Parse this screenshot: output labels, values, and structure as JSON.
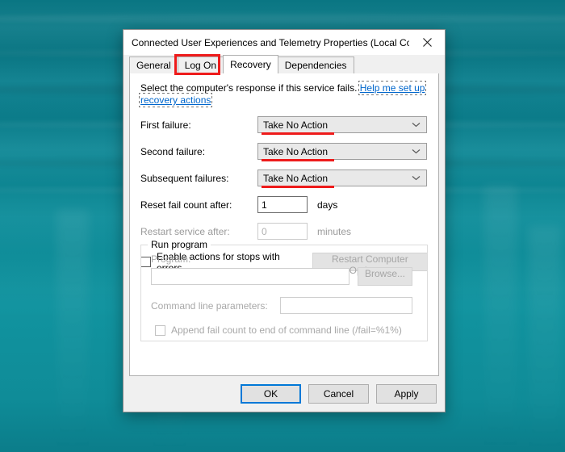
{
  "desktop": {
    "wallpaper_name": "teal-ocean-wallpaper"
  },
  "window": {
    "title": "Connected User Experiences and Telemetry Properties (Local Comp...",
    "close_icon": "close-icon"
  },
  "tabs": [
    {
      "label": "General",
      "active": false
    },
    {
      "label": "Log On",
      "active": false
    },
    {
      "label": "Recovery",
      "active": true
    },
    {
      "label": "Dependencies",
      "active": false
    }
  ],
  "annotations": {
    "tab_box_color": "#ee1b1b",
    "underline_color": "#ee1b1b"
  },
  "recovery": {
    "intro_text": "Select the computer's response if this service fails.",
    "help_link": "Help me set up recovery actions",
    "failure_rows": [
      {
        "label": "First failure:",
        "value": "Take No Action",
        "chevron": "chevron-down-icon"
      },
      {
        "label": "Second failure:",
        "value": "Take No Action",
        "chevron": "chevron-down-icon"
      },
      {
        "label": "Subsequent failures:",
        "value": "Take No Action",
        "chevron": "chevron-down-icon"
      }
    ],
    "reset_fail_count": {
      "label": "Reset fail count after:",
      "value": "1",
      "unit": "days"
    },
    "restart_service_after": {
      "label": "Restart service after:",
      "value": "0",
      "unit": "minutes"
    },
    "enable_actions": {
      "label": "Enable actions for stops with errors.",
      "checked": false
    },
    "restart_computer_options_button": "Restart Computer Options...",
    "run_program": {
      "legend": "Run program",
      "program_label": "Program:",
      "program_value": "",
      "browse_button": "Browse...",
      "command_line_label": "Command line parameters:",
      "command_line_value": "",
      "append_checkbox": "Append fail count to end of command line (/fail=%1%)",
      "append_checked": false
    }
  },
  "footer": {
    "ok": "OK",
    "cancel": "Cancel",
    "apply": "Apply",
    "default_button_color": "#0078d7"
  }
}
